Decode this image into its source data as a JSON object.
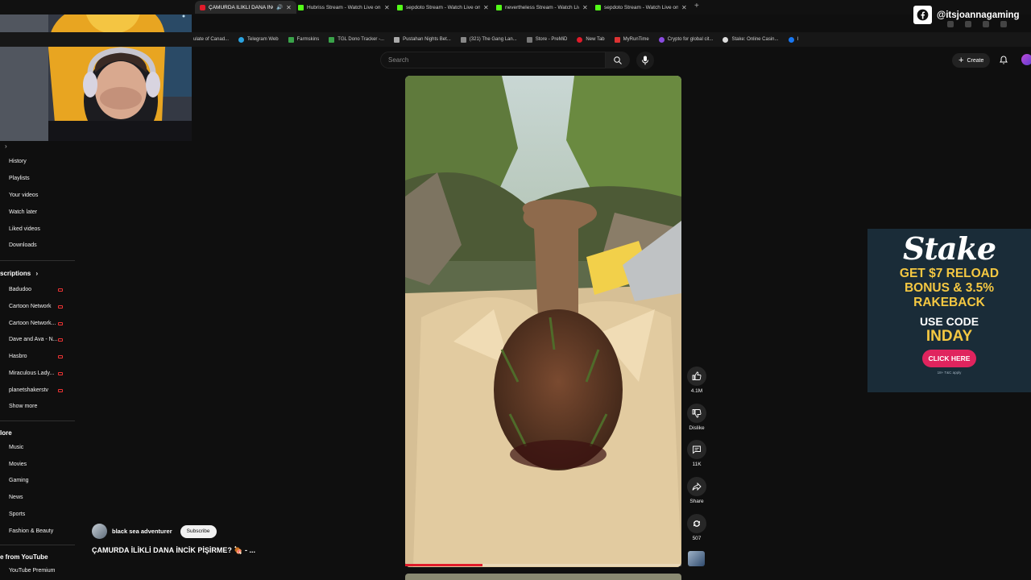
{
  "stream_overlay": {
    "social_handle": "@itsjoannagaming",
    "social_icon": "facebook-icon"
  },
  "browser": {
    "tabs": [
      {
        "title": "ÇAMURDA İLİKLİ DANA İNC",
        "active": true,
        "favicon": "youtube-icon"
      },
      {
        "title": "Hubriss Stream - Watch Live on",
        "active": false,
        "favicon": "kick-icon"
      },
      {
        "title": "sepdoto Stream - Watch Live on",
        "active": false,
        "favicon": "kick-icon"
      },
      {
        "title": "nevertheless Stream - Watch Live",
        "active": false,
        "favicon": "kick-icon"
      },
      {
        "title": "sepdoto Stream - Watch Live on",
        "active": false,
        "favicon": "kick-icon"
      }
    ],
    "bookmarks": [
      "ulate of Canad...",
      "Telegram Web",
      "Farmskins",
      "TGL Dono Tracker -...",
      "Pustahan Nights Bet...",
      "(321) The Gang Lan...",
      "Store - PreMiD",
      "New Tab",
      "MyRunTime",
      "Crypto for global cit...",
      "Stake: Online Casin...",
      "I"
    ]
  },
  "header": {
    "search_placeholder": "Search",
    "create_label": "Create"
  },
  "sidebar": {
    "you_items": [
      "History",
      "Playlists",
      "Your videos",
      "Watch later",
      "Liked videos",
      "Downloads"
    ],
    "subscriptions_heading": "scriptions",
    "subscriptions": [
      "Badudoo",
      "Cartoon Network",
      "Cartoon Network...",
      "Dave and Ava - N...",
      "Hasbro",
      "Miraculous Lady...",
      "planetshakerstv"
    ],
    "show_more": "Show more",
    "explore_heading": "lore",
    "explore": [
      "Music",
      "Movies",
      "Gaming",
      "News",
      "Sports",
      "Fashion & Beauty"
    ],
    "more_heading": "e from YouTube",
    "more": [
      "YouTube Premium"
    ]
  },
  "short": {
    "channel_name": "black sea adventurer",
    "subscribe_label": "Subscribe",
    "title": "ÇAMURDA İLİKLİ DANA İNCİK PİŞİRME? 🍖 - ...",
    "progress": 0.28,
    "actions": {
      "likes": "4.1M",
      "dislike": "Dislike",
      "comments": "11K",
      "share": "Share",
      "remix": "507"
    }
  },
  "ad": {
    "brand": "Stake",
    "lines": [
      "GET $7 RELOAD",
      "BONUS & 3.5%",
      "RAKEBACK"
    ],
    "code_label": "USE CODE",
    "code": "INDAY",
    "cta": "CLICK HERE",
    "disclaimer": "18+ T&C apply",
    "accent": "#f5c842",
    "cta_color": "#e0245e"
  }
}
